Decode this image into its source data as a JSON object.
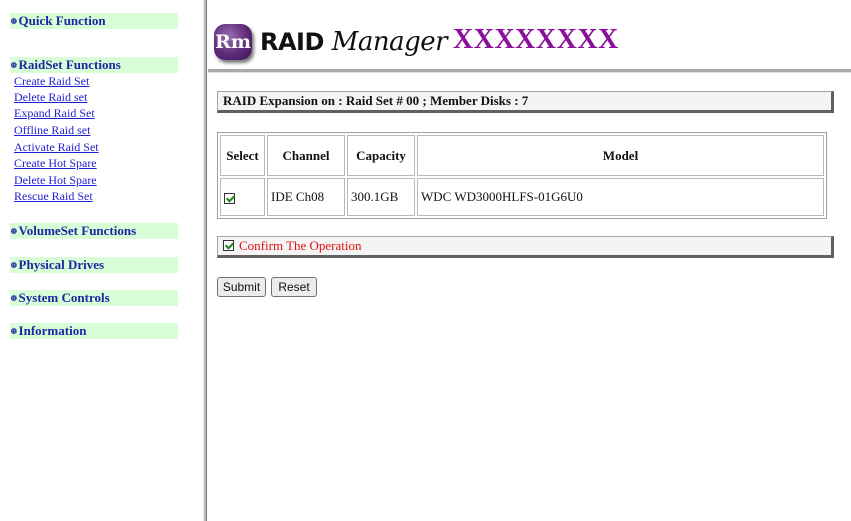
{
  "sidebar": {
    "quick_function": "Quick Function",
    "raidset_functions": "RaidSet Functions",
    "raidset_items": [
      "Create Raid Set",
      "Delete Raid set",
      "Expand Raid Set",
      "Offline Raid set",
      "Activate Raid Set",
      "Create Hot Spare",
      "Delete Hot Spare",
      "Rescue Raid Set"
    ],
    "volumeset_functions": "VolumeSet Functions",
    "physical_drives": "Physical Drives",
    "system_controls": "System Controls",
    "information": "Information",
    "bullet": "⊕",
    "header_bg": "#d9fdd6",
    "header_color": "#1b27a3",
    "link_color": "#1f1fd0"
  },
  "header": {
    "logo_text": "Rm",
    "app_name_bold": "RAID",
    "app_name_script": "Manager",
    "model": "XXXXXXXX",
    "model_color": "#8a0f99"
  },
  "main": {
    "title": "RAID Expansion on : Raid Set # 00 ; Member Disks : 7",
    "table": {
      "headers": [
        "Select",
        "Channel",
        "Capacity",
        "Model"
      ],
      "rows": [
        {
          "selected": true,
          "channel": "IDE Ch08",
          "capacity": "300.1GB",
          "model": "WDC WD3000HLFS-01G6U0"
        }
      ]
    },
    "confirm_label": "Confirm The Operation",
    "confirm_checked": true,
    "confirm_color": "#e01010",
    "submit_label": "Submit",
    "reset_label": "Reset"
  }
}
